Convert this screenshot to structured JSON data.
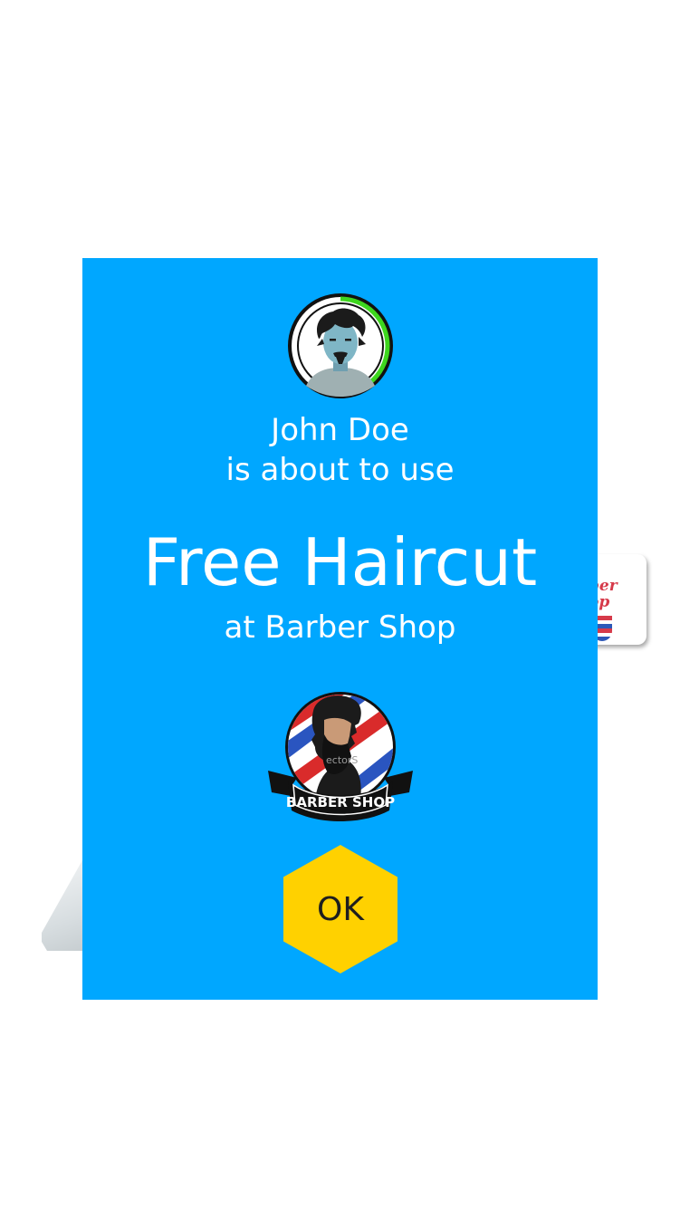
{
  "dialog": {
    "user_name": "John Doe",
    "action_text": "is about to use",
    "offer_title": "Free Haircut",
    "venue_text": "at Barber Shop",
    "ok_label": "OK"
  },
  "logo": {
    "banner_text": "BARBER SHOP",
    "watermark_text": "ectorS"
  },
  "background": {
    "card_logo_text": "ber op"
  },
  "colors": {
    "modal_background": "#00a7ff",
    "ok_button": "#ffd100",
    "avatar_progress_ring": "#3ed61e",
    "text": "#ffffff"
  },
  "icons": {
    "avatar": "user-avatar-icon",
    "shop_logo": "barber-shop-logo-icon"
  }
}
